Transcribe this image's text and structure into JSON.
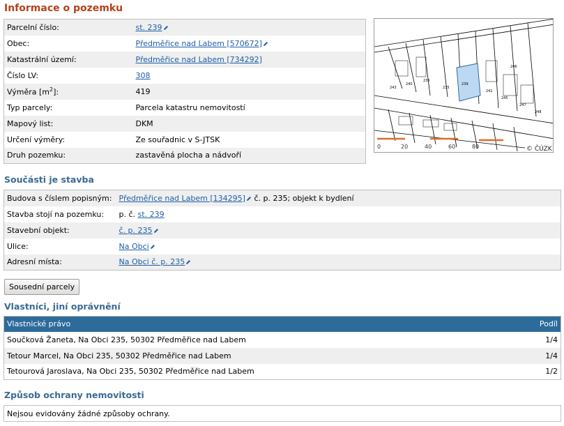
{
  "title": "Informace o pozemku",
  "parcel": {
    "rows": [
      {
        "label": "Parcelní číslo:",
        "value": "st. 239",
        "link": true,
        "edit": true
      },
      {
        "label": "Obec:",
        "value": "Předměřice nad Labem [570672]",
        "link": true,
        "edit": true
      },
      {
        "label": "Katastrální území:",
        "value": "Předměřice nad Labem [734292]",
        "link": true,
        "edit": false
      },
      {
        "label": "Číslo LV:",
        "value": "308",
        "link": true,
        "edit": false
      },
      {
        "label_pre": "Výměra [m",
        "label_sup": "2",
        "label_post": "]:",
        "value": "419",
        "link": false
      },
      {
        "label": "Typ parcely:",
        "value": "Parcela katastru nemovitostí",
        "link": false
      },
      {
        "label": "Mapový list:",
        "value": "DKM",
        "link": false
      },
      {
        "label": "Určení výměry:",
        "value": "Ze souřadnic v S-JTSK",
        "link": false
      },
      {
        "label": "Druh pozemku:",
        "value": "zastavěná plocha a nádvoří",
        "link": false
      }
    ]
  },
  "map": {
    "copyright": "© ČÚZK",
    "scale_labels": [
      "0",
      "20",
      "40",
      "60",
      "80"
    ],
    "parcel_labels": [
      "235",
      "236",
      "239",
      "240",
      "241",
      "243",
      "245",
      "246",
      "247",
      "248"
    ],
    "highlight_color": "#bcd8f2",
    "road_color": "#e06a2a"
  },
  "building": {
    "title": "Součásti je stavba",
    "rows": [
      {
        "label": "Budova s číslem popisným:",
        "value": "Předměřice nad Labem [134295]",
        "suffix": " č. p. 235; objekt k bydlení"
      },
      {
        "label": "Stavba stojí na pozemku:",
        "prefix": "p. č. ",
        "value": "st. 239"
      },
      {
        "label": "Stavební objekt:",
        "value": "č. p. 235"
      },
      {
        "label": "Ulice:",
        "value": "Na Obci"
      },
      {
        "label": "Adresní místa:",
        "value": "Na Obci č. p. 235"
      }
    ]
  },
  "neighbors_button": "Sousední parcely",
  "owners": {
    "title": "Vlastníci, jiní oprávnění",
    "header_left": "Vlastnické právo",
    "header_right": "Podíl",
    "rows": [
      {
        "name": "Součková Žaneta, Na Obci 235, 50302 Předměřice nad Labem",
        "share": "1/4"
      },
      {
        "name": "Tetour Marcel, Na Obci 235, 50302 Předměřice nad Labem",
        "share": "1/4"
      },
      {
        "name": "Tetourová Jaroslava, Na Obci 235, 50302 Předměřice nad Labem",
        "share": "1/2"
      }
    ]
  },
  "protection": {
    "title": "Způsob ochrany nemovitosti",
    "text": "Nejsou evidovány žádné způsoby ochrany."
  },
  "colors": {
    "title": "#b3421b",
    "section": "#3a6a95",
    "link": "#1f5ea8",
    "table_header": "#2d6b9a"
  }
}
